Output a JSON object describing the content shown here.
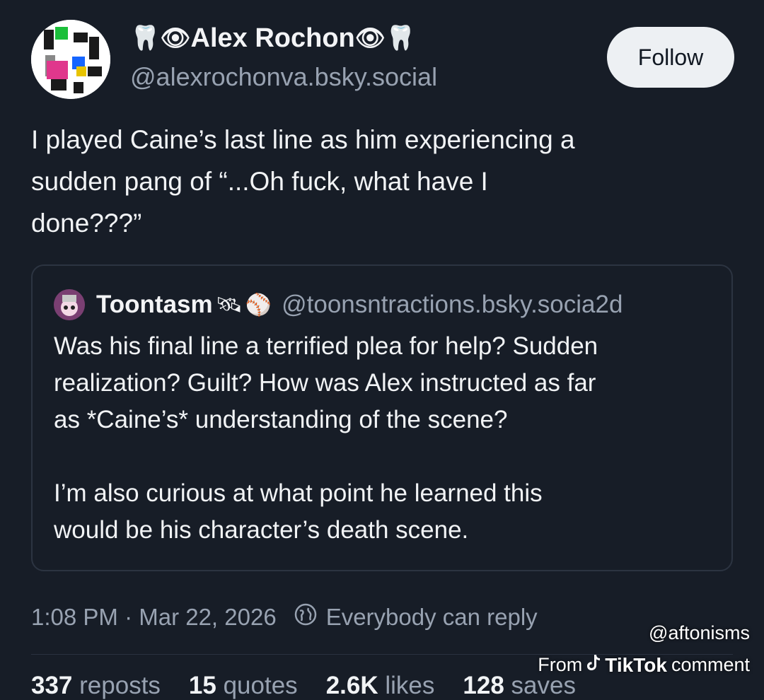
{
  "post": {
    "display_name": "Alex Rochon",
    "name_emoji_left": [
      "🦷",
      "👁"
    ],
    "name_emoji_right": [
      "👁",
      "🦷"
    ],
    "handle": "@alexrochonva.bsky.social",
    "follow_label": "Follow",
    "text": "I played Caine’s last line as him experiencing a\nsudden pang of “...Oh fuck, what have I\ndone???”",
    "timestamp": "1:08 PM · Mar 22, 2026",
    "reply_setting": "Everybody can reply"
  },
  "quote": {
    "display_name": "Toontasm",
    "name_emoji": [
      "🛰",
      "⚾"
    ],
    "handle": "@toonsntractions.bsky.socia",
    "time": "2d",
    "text": "Was his final line a terrified plea for help? Sudden\nrealization? Guilt? How was Alex instructed as far\nas *Caine’s* understanding of the scene?\n\nI’m also curious at what point he learned this\nwould be his character’s death scene."
  },
  "stats": [
    {
      "count": "337",
      "label": "reposts"
    },
    {
      "count": "15",
      "label": "quotes"
    },
    {
      "count": "2.6K",
      "label": "likes"
    },
    {
      "count": "128",
      "label": "saves"
    }
  ],
  "watermark": {
    "user": "@aftonisms",
    "from_label": "From",
    "brand": "TikTok",
    "comment_label": "comment"
  },
  "colors": {
    "background": "#171d27",
    "text": "#f1f3f5",
    "muted": "#98a2b1",
    "follow_button": "#edf0f3"
  },
  "icons": {
    "avatar": "pixel-art-avatar",
    "reply_setting": "globe-icon",
    "watermark": "tiktok-note-icon"
  }
}
